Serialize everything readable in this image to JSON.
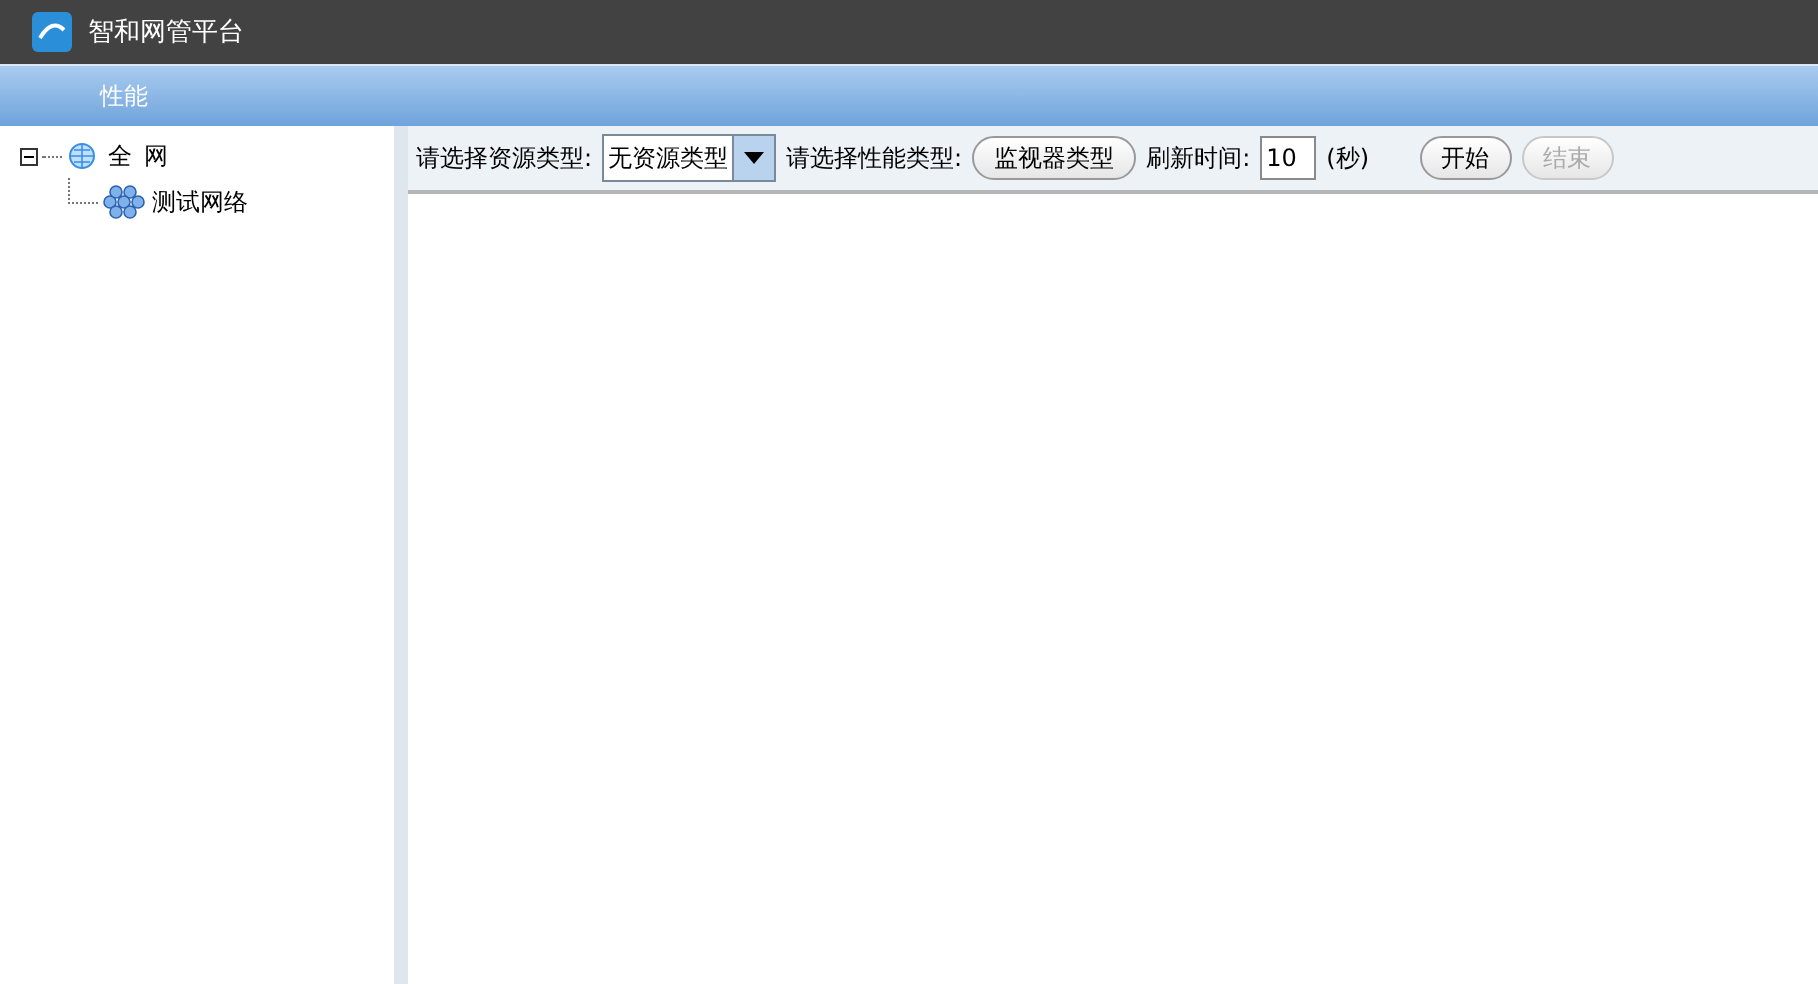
{
  "window": {
    "title": "智和网管平台"
  },
  "panel": {
    "title": "性能"
  },
  "tree": {
    "items": [
      {
        "label": "全 网",
        "expanded": true,
        "children": [
          {
            "label": "测试网络"
          }
        ]
      }
    ]
  },
  "toolbar": {
    "resource_label": "请选择资源类型:",
    "resource_value": "无资源类型",
    "perf_label": "请选择性能类型:",
    "perf_button": "监视器类型",
    "refresh_label": "刷新时间:",
    "refresh_value": "10",
    "unit": "(秒)",
    "buttons": [
      {
        "label": "开始",
        "disabled": false
      },
      {
        "label": "结束",
        "disabled": true
      }
    ]
  }
}
